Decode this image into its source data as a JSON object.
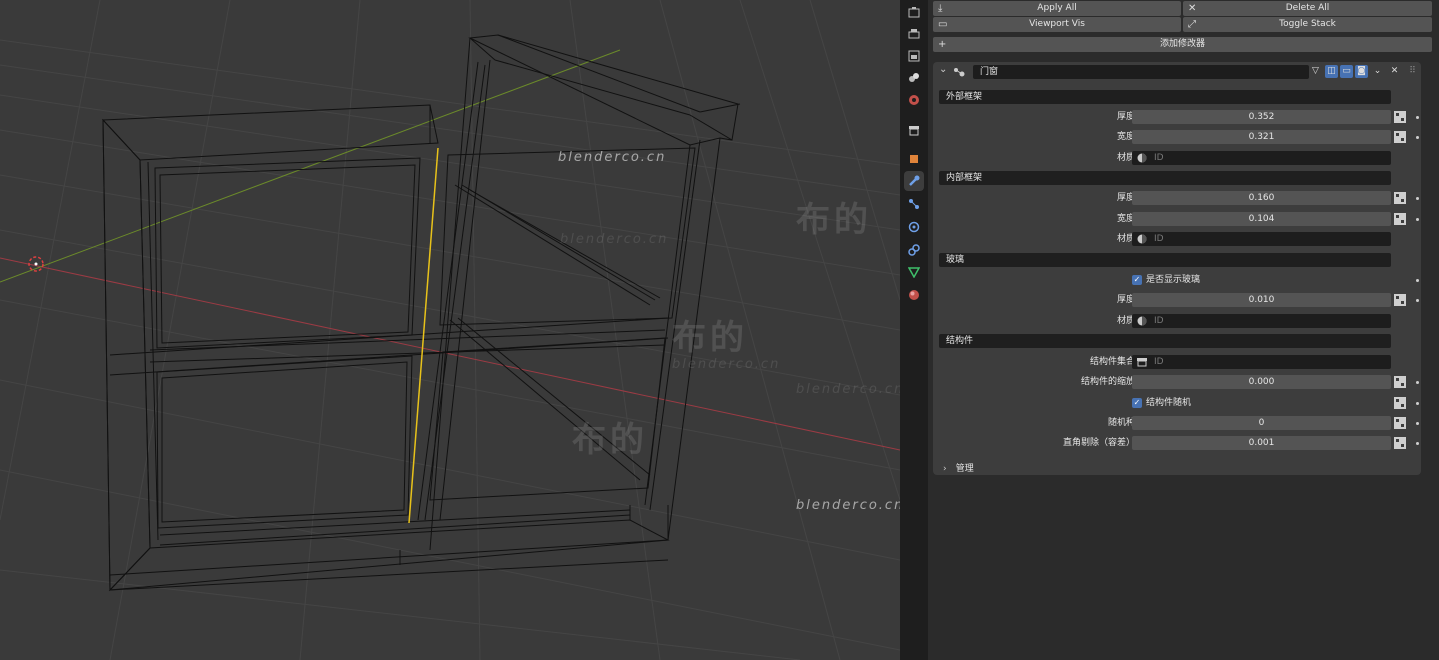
{
  "toolbar": {
    "apply_all": "Apply All",
    "delete_all": "Delete All",
    "viewport_vis": "Viewport Vis",
    "toggle_stack": "Toggle Stack",
    "add_modifier": "添加修改器"
  },
  "modifier": {
    "name": "门窗",
    "sections": {
      "outer_frame": "外部框架",
      "inner_frame": "内部框架",
      "glass": "玻璃",
      "structure": "结构件",
      "manage": "管理"
    },
    "outer": {
      "thickness_label": "厚度",
      "thickness": "0.352",
      "width_label": "宽度",
      "width": "0.321",
      "material_label": "材质",
      "material_placeholder": "ID"
    },
    "inner": {
      "thickness_label": "厚度",
      "thickness": "0.160",
      "width_label": "宽度",
      "width": "0.104",
      "material_label": "材质",
      "material_placeholder": "ID"
    },
    "glass": {
      "show_label": "是否显示玻璃",
      "thickness_label": "厚度",
      "thickness": "0.010",
      "material_label": "材质",
      "material_placeholder": "ID"
    },
    "structure": {
      "collection_label": "结构件集合",
      "collection_placeholder": "ID",
      "scale_label": "结构件的缩放",
      "scale": "0.000",
      "random_label": "结构件随机",
      "seed_label": "随机种",
      "seed": "0",
      "bevel_label": "直角剔除（容差）",
      "bevel": "0.001"
    }
  },
  "watermarks": {
    "site": "blenderco.cn",
    "brand": "布的"
  },
  "colors": {
    "accent": "#4772b3",
    "selected_edge": "#e8c21a",
    "x_axis": "#9c3b44",
    "y_axis": "#6b8a2a"
  }
}
